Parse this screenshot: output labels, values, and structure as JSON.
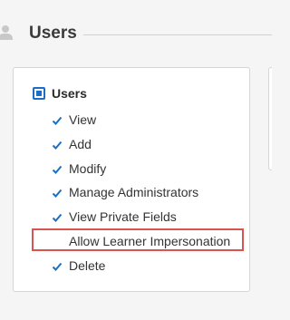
{
  "section": {
    "title": "Users",
    "icon": "user-icon"
  },
  "permissions_group": {
    "label": "Users",
    "checkbox_state": "partial",
    "items": [
      {
        "label": "View",
        "checked": true
      },
      {
        "label": "Add",
        "checked": true
      },
      {
        "label": "Modify",
        "checked": true
      },
      {
        "label": "Manage Administrators",
        "checked": true
      },
      {
        "label": "View Private Fields",
        "checked": true
      },
      {
        "label": "Allow Learner Impersonation",
        "checked": false,
        "highlighted": true
      },
      {
        "label": "Delete",
        "checked": true
      }
    ]
  },
  "colors": {
    "accent": "#1a6fc4",
    "highlight": "#d9534f",
    "check": "#1a6fc4"
  }
}
